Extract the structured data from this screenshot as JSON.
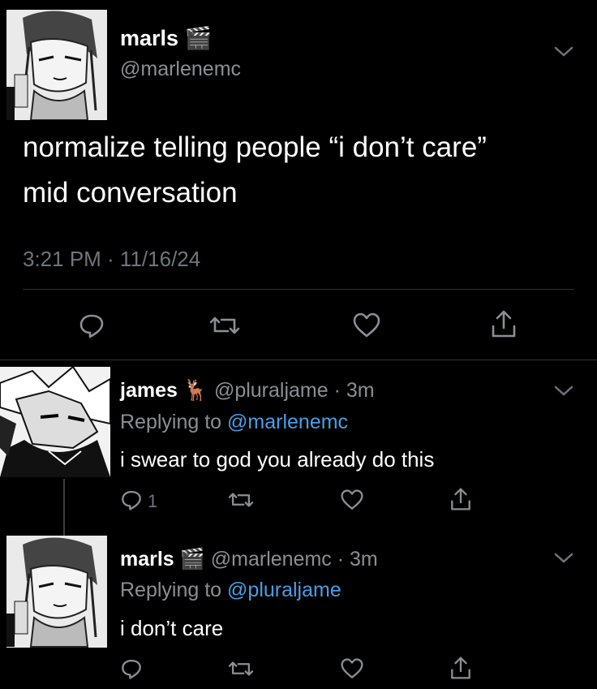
{
  "main_tweet": {
    "author_name": "marls",
    "author_emoji": "🎬",
    "handle": "@marlenemc",
    "text_line1": "normalize telling people “i don’t care”",
    "text_line2": "mid conversation",
    "timestamp": "3:21 PM · 11/16/24",
    "icons": [
      "reply-icon",
      "retweet-icon",
      "like-icon",
      "share-icon"
    ]
  },
  "reply1": {
    "author_name": "james",
    "author_emoji": "🦌",
    "handle_time": "@pluraljame · 3m",
    "replying_prefix": "Replying to ",
    "replying_handle": "@marlenemc",
    "text": "i swear to god you already do this",
    "reply_count": "1"
  },
  "reply2": {
    "author_name": "marls",
    "author_emoji": "🎬",
    "handle_time": "@marlenemc · 3m",
    "replying_prefix": "Replying to ",
    "replying_handle": "@pluraljame",
    "text": "i don’t care"
  },
  "colors": {
    "background": "#000000",
    "text": "#ffffff",
    "secondary": "#8b8f94",
    "link": "#4a9de6"
  }
}
